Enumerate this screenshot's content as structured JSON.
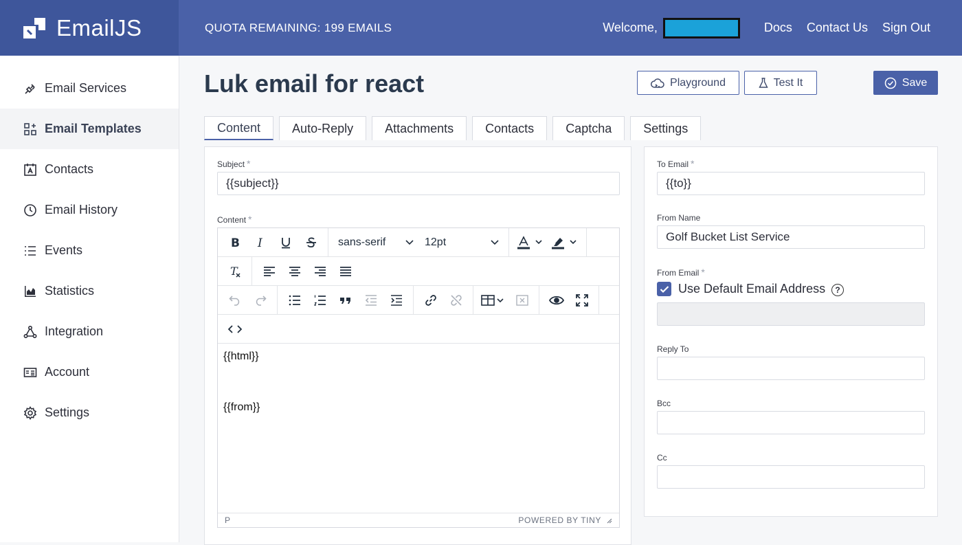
{
  "header": {
    "brand": "EmailJS",
    "quota": "QUOTA REMAINING: 199 EMAILS",
    "welcome": "Welcome,",
    "links": [
      "Docs",
      "Contact Us",
      "Sign Out"
    ],
    "redaction_color": "#1ba2d9"
  },
  "sidebar": {
    "items": [
      {
        "label": "Email Services",
        "icon": "plug-icon"
      },
      {
        "label": "Email Templates",
        "icon": "templates-icon",
        "active": true
      },
      {
        "label": "Contacts",
        "icon": "contacts-icon"
      },
      {
        "label": "Email History",
        "icon": "history-icon"
      },
      {
        "label": "Events",
        "icon": "list-icon"
      },
      {
        "label": "Statistics",
        "icon": "chart-icon"
      },
      {
        "label": "Integration",
        "icon": "integration-icon"
      },
      {
        "label": "Account",
        "icon": "id-card-icon"
      },
      {
        "label": "Settings",
        "icon": "gear-icon"
      }
    ]
  },
  "page": {
    "title": "Luk email for react",
    "playground": "Playground",
    "test_it": "Test It",
    "save": "Save"
  },
  "tabs": [
    "Content",
    "Auto-Reply",
    "Attachments",
    "Contacts",
    "Captcha",
    "Settings"
  ],
  "content_panel": {
    "subject_label": "Subject",
    "subject_value": "{{subject}}",
    "content_label": "Content",
    "required_mark": "*",
    "font_family": "sans-serif",
    "font_size": "12pt",
    "body_lines": [
      "{{html}}",
      "{{from}}"
    ],
    "status_path": "P",
    "powered_by": "POWERED BY TINY"
  },
  "side_panel": {
    "to_email_label": "To Email",
    "to_email_value": "{{to}}",
    "from_name_label": "From Name",
    "from_name_value": "Golf Bucket List Service",
    "from_email_label": "From Email",
    "use_default_label": "Use Default Email Address",
    "use_default_checked": true,
    "help_glyph": "?",
    "reply_to_label": "Reply To",
    "bcc_label": "Bcc",
    "cc_label": "Cc"
  },
  "colors": {
    "accent": "#4a61a8",
    "brand_bg": "#3e569b"
  }
}
